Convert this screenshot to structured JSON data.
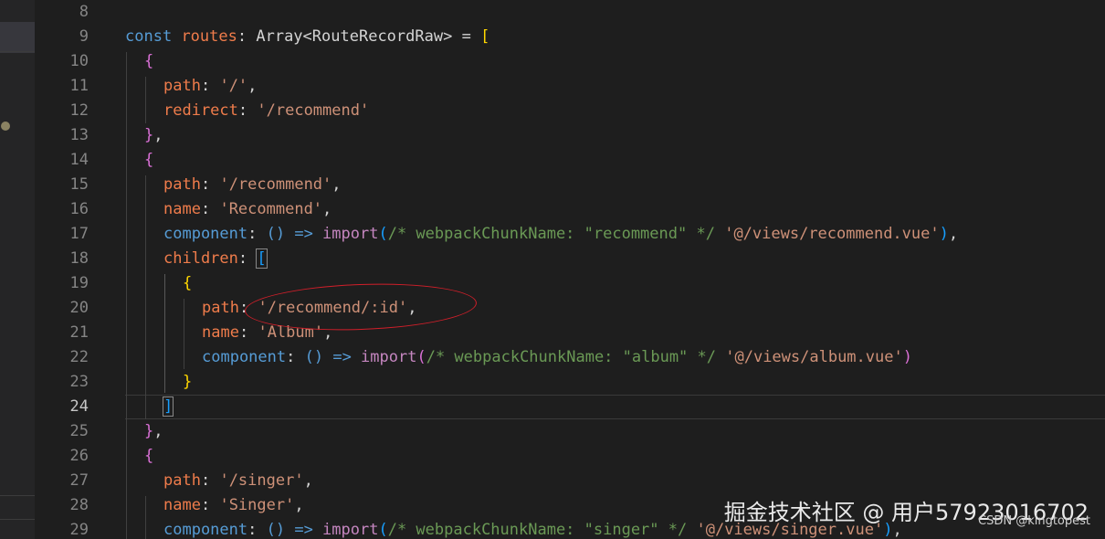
{
  "editor": {
    "line_numbers": [
      "8",
      "9",
      "10",
      "11",
      "12",
      "13",
      "14",
      "15",
      "16",
      "17",
      "18",
      "19",
      "20",
      "21",
      "22",
      "23",
      "24",
      "25",
      "26",
      "27",
      "28",
      "29"
    ],
    "active_line": "24",
    "tokens": {
      "const": "const",
      "routes": "routes",
      "colon": ":",
      "array_type": "Array",
      "lt": "<",
      "route_record_raw": "RouteRecordRaw",
      "gt": ">",
      "eq": " = ",
      "comma": ",",
      "path_key": "path",
      "redirect_key": "redirect",
      "name_key": "name",
      "component_key": "component",
      "children_key": "children",
      "import_kw": "import",
      "arrow_fn": "() => ",
      "str_root": "'/'",
      "str_recommend": "'/recommend'",
      "str_recommend_name": "'Recommend'",
      "str_recommend_view": "'@/views/recommend.vue'",
      "str_recommend_id": "'/recommend/:id'",
      "str_album_name": "'Album'",
      "str_album_view": "'@/views/album.vue'",
      "str_singer": "'/singer'",
      "str_singer_name": "'Singer'",
      "str_singer_view": "'@/views/singer.vue'",
      "comment_recommend": "/* webpackChunkName: \"recommend\" */",
      "comment_album": "/* webpackChunkName: \"album\" */",
      "comment_singer": "/* webpackChunkName: \"singer\" */",
      "open_square": "[",
      "close_square": "]",
      "open_brace": "{",
      "close_brace": "}",
      "close_brace_comma": "},",
      "open_paren": "(",
      "close_paren": ")",
      "close_paren_comma": "),",
      "space": " "
    }
  },
  "watermark": {
    "main": "掘金技术社区 @ 用户57923016702",
    "sub": "CSDN @kingtopest"
  },
  "colors": {
    "background": "#1e1e1e",
    "keyword_blue": "#569cd6",
    "keyword_purple": "#c586c0",
    "variable_orange": "#ef7c4b",
    "string": "#ce9178",
    "comment": "#6a9955",
    "annotation_red": "#d11f2a"
  }
}
